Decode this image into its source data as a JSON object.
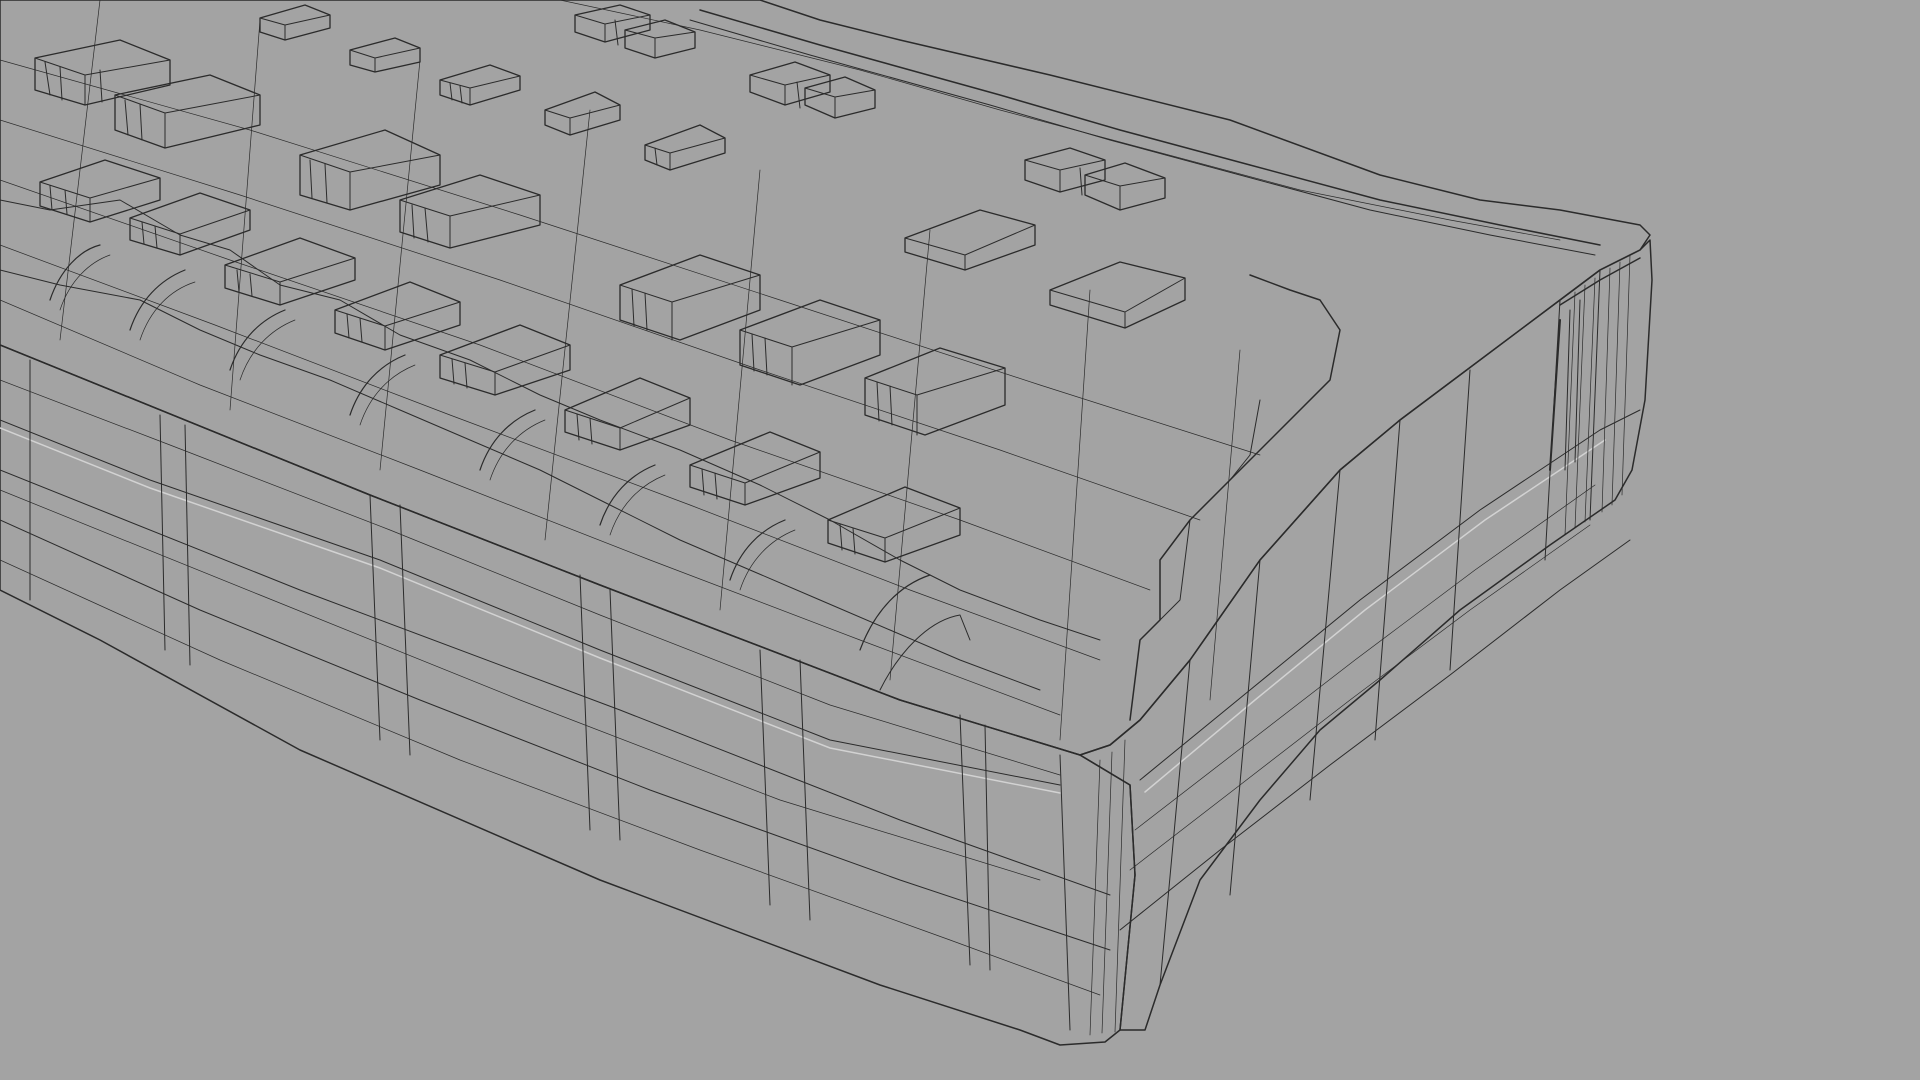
{
  "viewport": {
    "background": "#a3a3a3",
    "shading": "wireframe-on-shaded"
  },
  "model": {
    "object": "keyboard",
    "surface_color": "#a2a2a2",
    "top_face_color": "#a7a7a7",
    "wire_color": "#2b2b2b",
    "highlight_color": "#d2d2d2"
  }
}
